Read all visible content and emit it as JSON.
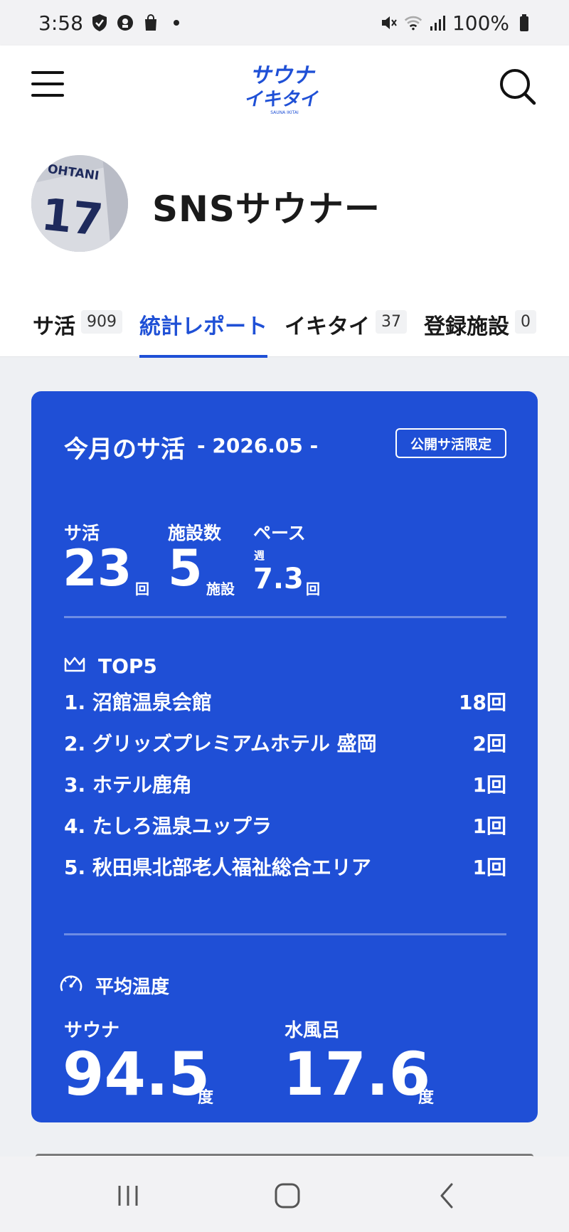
{
  "status_bar": {
    "time": "3:58",
    "battery": "100%",
    "icons": [
      "shield-check-icon",
      "vpn-icon",
      "shopping-bag-icon",
      "dot-icon",
      "mute-icon",
      "wifi-icon",
      "signal-icon",
      "battery-icon"
    ]
  },
  "header": {
    "logo_text_line1": "サウナ",
    "logo_text_line2": "イキタイ",
    "logo_sub": "SAUNA IKITAI",
    "menu_icon": "hamburger-icon",
    "search_icon": "search-icon"
  },
  "profile": {
    "username": "SNSサウナー",
    "avatar_text": "OHTANI",
    "avatar_number": "17"
  },
  "tabs": [
    {
      "label": "サ活",
      "count": "909",
      "active": false
    },
    {
      "label": "統計レポート",
      "count": "",
      "active": true
    },
    {
      "label": "イキタイ",
      "count": "37",
      "active": false
    },
    {
      "label": "登録施設",
      "count": "0",
      "active": false
    }
  ],
  "report": {
    "title": "今月のサ活",
    "period": "- 2026.05 -",
    "badge": "公開サ活限定",
    "stats": {
      "sakatsu_label": "サ活",
      "sakatsu_value": "23",
      "sakatsu_unit": "回",
      "facilities_label": "施設数",
      "facilities_value": "5",
      "facilities_unit": "施設",
      "pace_label": "ペース",
      "pace_prefix": "週",
      "pace_value": "7.3",
      "pace_unit": "回"
    },
    "top5_title": "TOP5",
    "top5": [
      {
        "name": "1. 沼館温泉会館",
        "count": "18回"
      },
      {
        "name": "2. グリッズプレミアムホテル 盛岡",
        "count": "2回"
      },
      {
        "name": "3. ホテル鹿角",
        "count": "1回"
      },
      {
        "name": "4. たしろ温泉ユップラ",
        "count": "1回"
      },
      {
        "name": "5. 秋田県北部老人福祉総合エリア",
        "count": "1回"
      }
    ],
    "avg_temp_title": "平均温度",
    "sauna_label": "サウナ",
    "sauna_value": "94.5",
    "water_label": "水風呂",
    "water_value": "17.6",
    "temp_unit": "度"
  },
  "colors": {
    "accent": "#1f50d6",
    "card_bg": "#1f4fd6"
  }
}
